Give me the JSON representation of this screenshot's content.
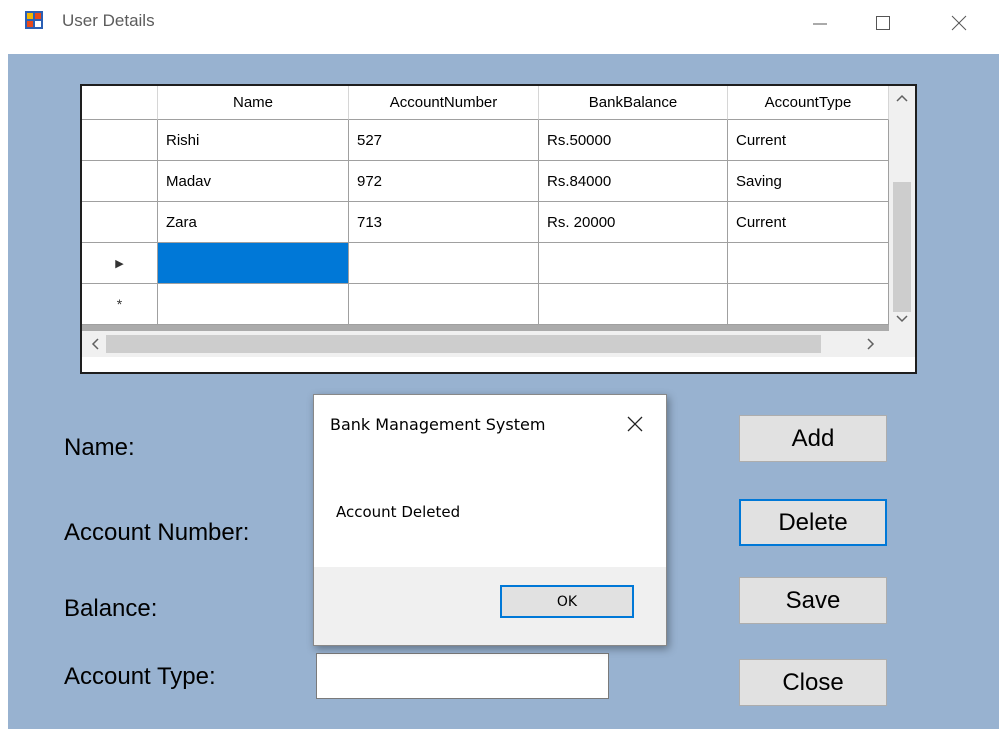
{
  "window": {
    "title": "User Details",
    "icon": "app-form-icon"
  },
  "grid": {
    "columns": [
      "Name",
      "AccountNumber",
      "BankBalance",
      "AccountType"
    ],
    "rows": [
      [
        "Rishi",
        "527",
        "Rs.50000",
        "Current"
      ],
      [
        "Madav",
        "972",
        "Rs.84000",
        "Saving"
      ],
      [
        "Zara",
        "713",
        "Rs. 20000",
        "Current"
      ]
    ],
    "current_row_marker": "▶",
    "new_row_marker": "*"
  },
  "form": {
    "name_label": "Name:",
    "account_number_label": "Account Number:",
    "balance_label": "Balance:",
    "account_type_label": "Account Type:",
    "account_type_value": ""
  },
  "buttons": {
    "add": "Add",
    "delete": "Delete",
    "save": "Save",
    "close": "Close"
  },
  "dialog": {
    "title": "Bank Management System",
    "message": "Account Deleted",
    "ok": "OK"
  },
  "colors": {
    "client_background": "#98b2d0",
    "selection": "#0078d7",
    "focus_border": "#0078d7"
  }
}
